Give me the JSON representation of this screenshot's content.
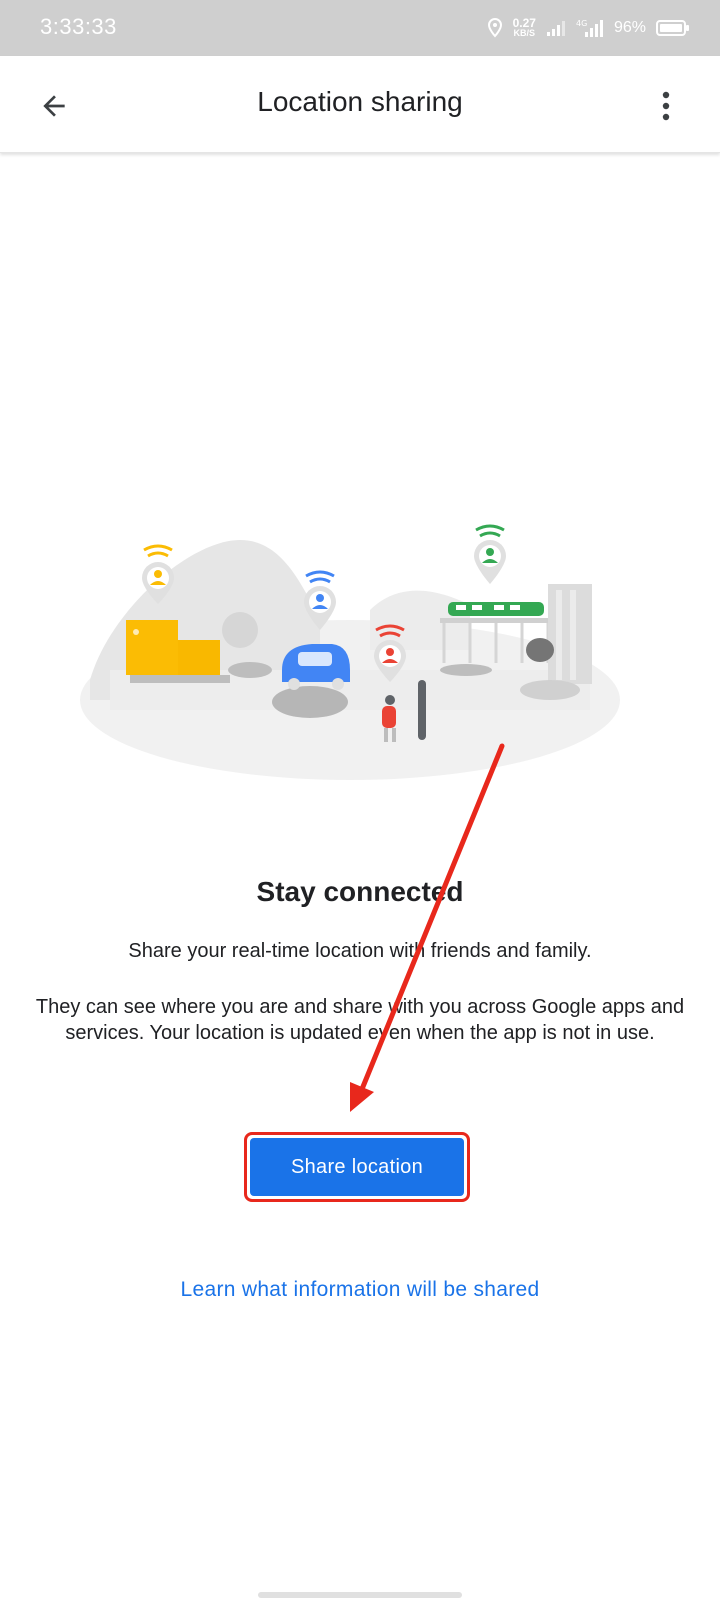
{
  "status_bar": {
    "time": "3:33:33",
    "net_speed_value": "0.27",
    "net_speed_unit": "KB/S",
    "battery": "96%",
    "icons": [
      "location-icon",
      "signal-icon",
      "4g-signal-icon",
      "battery-icon"
    ]
  },
  "app_bar": {
    "title": "Location sharing",
    "back_icon": "arrow-back-icon",
    "more_icon": "more-vert-icon"
  },
  "content": {
    "heading": "Stay connected",
    "body_primary": "Share your real-time location with friends and family.",
    "body_secondary": "They can see where you are and share with you across Google apps and services. Your location is updated even when the app is not in use.",
    "share_button": "Share location",
    "learn_link": "Learn what information will be shared"
  },
  "colors": {
    "primary": "#1a73e8",
    "annotation_red": "#e8281c",
    "status_bar": "#cfcfcf",
    "pin_yellow": "#fbbc04",
    "pin_blue": "#4285f4",
    "pin_red": "#ea4335",
    "pin_green": "#34a853"
  }
}
